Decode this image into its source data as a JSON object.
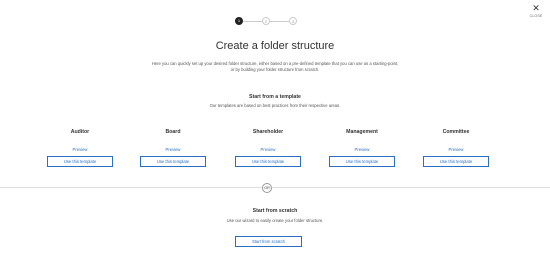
{
  "close": {
    "icon": "close-icon",
    "label": "CLOSE"
  },
  "stepper": {
    "steps": [
      "1",
      "2",
      "3"
    ],
    "active": 1
  },
  "title": "Create a folder structure",
  "intro": "Here you can quickly set up your desired folder structure, either based on a pre-defined template that you can use as a starting-point, or by building your folder structure from scratch.",
  "template_section": {
    "title": "Start from a template",
    "subtitle": "Our templates are based on best practices from their respective areas.",
    "templates": [
      {
        "name": "Auditor",
        "preview": "Preview",
        "use": "Use this template"
      },
      {
        "name": "Board",
        "preview": "Preview",
        "use": "Use this template"
      },
      {
        "name": "Shareholder",
        "preview": "Preview",
        "use": "Use this template"
      },
      {
        "name": "Management",
        "preview": "Preview",
        "use": "Use this template"
      },
      {
        "name": "Committee",
        "preview": "Preview",
        "use": "Use this template"
      }
    ]
  },
  "divider_label": "OR",
  "scratch_section": {
    "title": "Start from scratch",
    "description": "Use our wizard to easily create your folder structure.",
    "button": "Start from scratch"
  },
  "colors": {
    "accent": "#2a6fc0",
    "active_step": "#222222",
    "divider": "#dddddd"
  }
}
